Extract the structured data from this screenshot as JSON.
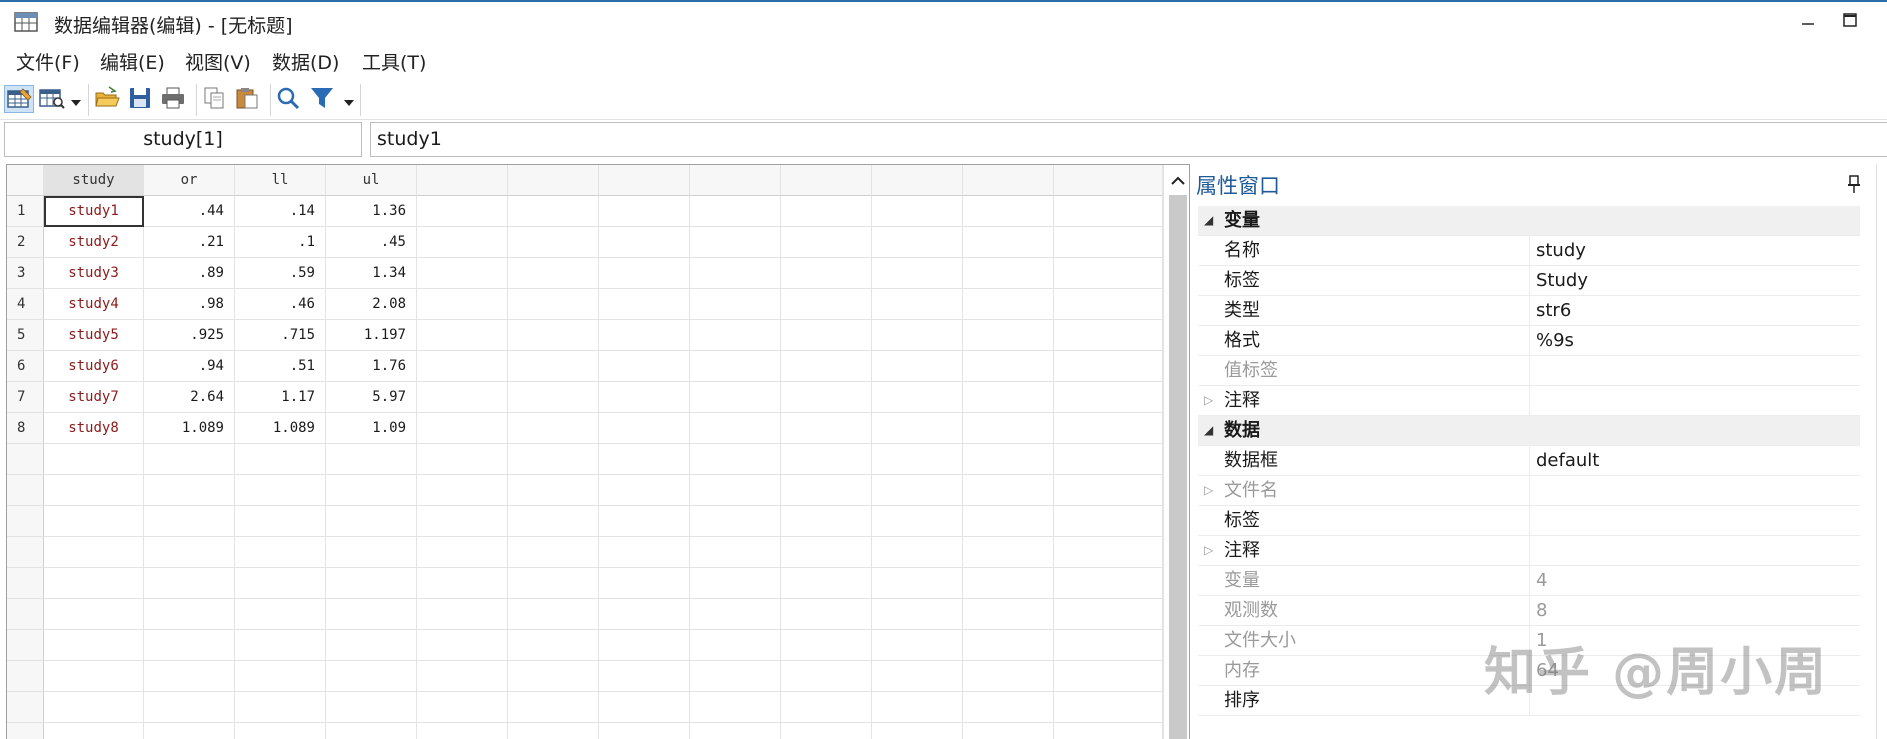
{
  "window": {
    "title": "数据编辑器(编辑) - [无标题]"
  },
  "menu": [
    "文件(F)",
    "编辑(E)",
    "视图(V)",
    "数据(D)",
    "工具(T)"
  ],
  "toolbar": {
    "icons": [
      "edit-mode-icon",
      "browse-mode-icon",
      "open-folder-icon",
      "save-icon",
      "print-icon",
      "copy-icon",
      "paste-icon",
      "search-icon",
      "filter-icon"
    ]
  },
  "address": {
    "cell_ref": "study[1]",
    "cell_value": "study1"
  },
  "grid": {
    "columns": [
      "study",
      "or",
      "ll",
      "ul"
    ],
    "rows": [
      {
        "n": "1",
        "study": "study1",
        "or": ".44",
        "ll": ".14",
        "ul": "1.36"
      },
      {
        "n": "2",
        "study": "study2",
        "or": ".21",
        "ll": ".1",
        "ul": ".45"
      },
      {
        "n": "3",
        "study": "study3",
        "or": ".89",
        "ll": ".59",
        "ul": "1.34"
      },
      {
        "n": "4",
        "study": "study4",
        "or": ".98",
        "ll": ".46",
        "ul": "2.08"
      },
      {
        "n": "5",
        "study": "study5",
        "or": ".925",
        "ll": ".715",
        "ul": "1.197"
      },
      {
        "n": "6",
        "study": "study6",
        "or": ".94",
        "ll": ".51",
        "ul": "1.76"
      },
      {
        "n": "7",
        "study": "study7",
        "or": "2.64",
        "ll": "1.17",
        "ul": "5.97"
      },
      {
        "n": "8",
        "study": "study8",
        "or": "1.089",
        "ll": "1.089",
        "ul": "1.09"
      }
    ]
  },
  "properties": {
    "title": "属性窗口",
    "variable": {
      "header": "变量",
      "name_k": "名称",
      "name_v": "study",
      "label_k": "标签",
      "label_v": "Study",
      "type_k": "类型",
      "type_v": "str6",
      "format_k": "格式",
      "format_v": "%9s",
      "vlabel_k": "值标签",
      "vlabel_v": "",
      "notes_k": "注释",
      "notes_v": ""
    },
    "data": {
      "header": "数据",
      "frame_k": "数据框",
      "frame_v": "default",
      "filename_k": "文件名",
      "filename_v": "",
      "label_k": "标签",
      "label_v": "",
      "notes_k": "注释",
      "notes_v": "",
      "vars_k": "变量",
      "vars_v": "4",
      "obs_k": "观测数",
      "obs_v": "8",
      "size_k": "文件大小",
      "size_v": "1",
      "mem_k": "内存",
      "mem_v": "64",
      "sort_k": "排序",
      "sort_v": ""
    }
  },
  "watermark": "知乎 @周小周"
}
